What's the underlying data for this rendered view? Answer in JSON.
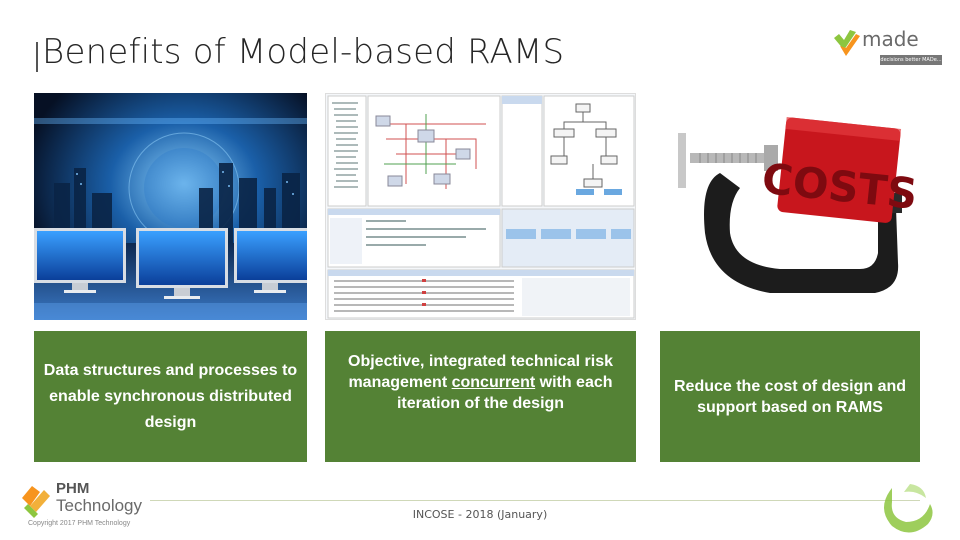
{
  "slide": {
    "title": "Benefits of Model-based RAMS",
    "footer": "INCOSE - 2018 (January)"
  },
  "logos": {
    "made_name": "made",
    "made_tagline": "decisions better MADe...",
    "phm_line1": "PHM",
    "phm_line2": "Technology",
    "phm_copyright": "Copyright 2017 PHM Technology"
  },
  "pictures": {
    "pic3_text": "COSTS"
  },
  "boxes": {
    "box1": "Data structures and processes to enable synchronous distributed design",
    "box2_part1": "Objective, integrated technical risk management ",
    "box2_underlined": "concurrent",
    "box2_part2": " with each iteration of the design",
    "box3": "Reduce the cost of design and support based on RAMS"
  },
  "colors": {
    "box_green": "#548235",
    "made_green": "#8dc63f",
    "phm_orange": "#f7941d"
  }
}
